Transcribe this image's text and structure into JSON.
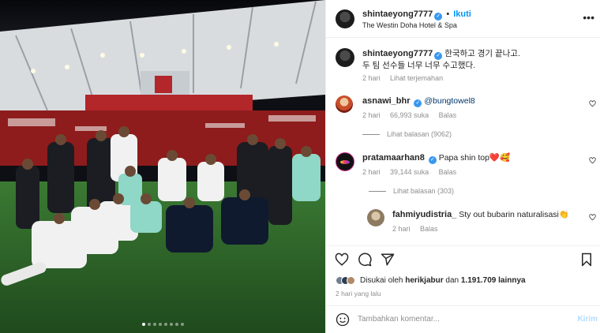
{
  "post": {
    "author": "shintaeyong7777",
    "follow_label": "Ikuti",
    "location": "The Westin Doha Hotel & Spa",
    "more_label": "•••",
    "stadium_sign": "ABDULLAH BIN KHALIFA STADIUM",
    "carousel_count": 8,
    "carousel_active": 0
  },
  "caption": {
    "username": "shintaeyong7777",
    "text_line1": "한국하고 경기 끝나고.",
    "text_line2": "두 팀 선수들 너무 너무 수고했다.",
    "time": "2 hari",
    "translate_label": "Lihat terjemahan"
  },
  "comments": [
    {
      "username": "asnawi_bhr",
      "text": "@bungtowel8",
      "time": "2 hari",
      "likes": "66,993 suka",
      "reply_label": "Balas",
      "view_replies": "Lihat balasan (9062)"
    },
    {
      "username": "pratamaarhan8",
      "text": "Papa shin top❤️🥰",
      "time": "2 hari",
      "likes": "39,144 suka",
      "reply_label": "Balas",
      "view_replies": "Lihat balasan (303)"
    },
    {
      "username": "fahmiyudistria_",
      "text": "Sty out bubarin naturalisasi👏",
      "time": "2 hari",
      "reply_label": "Balas"
    }
  ],
  "actions": {
    "liked_by_prefix": "Disukai oleh",
    "liked_by_user": "herikjabur",
    "liked_by_and": "dan",
    "liked_by_count": "1.191.709 lainnya",
    "time_ago": "2 hari yang lalu"
  },
  "add_comment": {
    "placeholder": "Tambahkan komentar...",
    "post_label": "Kirim"
  },
  "colors": {
    "accent": "#0095f6",
    "verified": "#3897f0",
    "heart": "#ed4956",
    "muted": "#8e8e8e",
    "pitch": "#2f6a2c",
    "stand_red": "#b8201f"
  }
}
